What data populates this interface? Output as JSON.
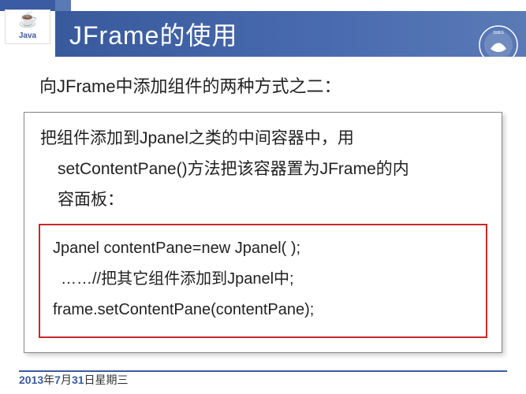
{
  "logo": {
    "text": "Java"
  },
  "title": "JFrame的使用",
  "subtitle": "向JFrame中添加组件的两种方式之二：",
  "desc_line1": "把组件添加到Jpanel之类的中间容器中，用",
  "desc_line2": "setContentPane()方法把该容器置为JFrame的内",
  "desc_line3": "容面板：",
  "code": {
    "l1": "Jpanel contentPane=new Jpanel( );",
    "l2": "……//把其它组件添加到Jpanel中;",
    "l3": "frame.setContentPane(contentPane);"
  },
  "footer": {
    "y": "2013",
    "t1": "年",
    "m": "7",
    "t2": "月",
    "d": "31",
    "t3": "日星期三"
  }
}
